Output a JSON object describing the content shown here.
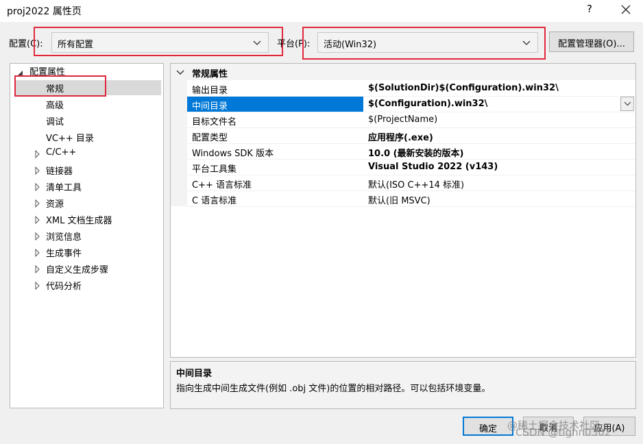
{
  "window": {
    "title": "proj2022 属性页",
    "help_label": "?"
  },
  "toolbar": {
    "config_label": "配置(C):",
    "config_value": "所有配置",
    "platform_label": "平台(P):",
    "platform_value": "活动(Win32)",
    "config_manager_label": "配置管理器(O)..."
  },
  "colors": {
    "highlight_box": "#e0283a",
    "selection": "#0078d7"
  },
  "tree": {
    "root": "配置属性",
    "items": [
      {
        "label": "常规",
        "expandable": false,
        "selected": true
      },
      {
        "label": "高级",
        "expandable": false
      },
      {
        "label": "调试",
        "expandable": false
      },
      {
        "label": "VC++ 目录",
        "expandable": false
      },
      {
        "label": "C/C++",
        "expandable": true
      },
      {
        "label": "链接器",
        "expandable": true
      },
      {
        "label": "清单工具",
        "expandable": true
      },
      {
        "label": "资源",
        "expandable": true
      },
      {
        "label": "XML 文档生成器",
        "expandable": true
      },
      {
        "label": "浏览信息",
        "expandable": true
      },
      {
        "label": "生成事件",
        "expandable": true
      },
      {
        "label": "自定义生成步骤",
        "expandable": true
      },
      {
        "label": "代码分析",
        "expandable": true
      }
    ]
  },
  "properties": {
    "group_title": "常规属性",
    "rows": [
      {
        "name": "输出目录",
        "value": "$(SolutionDir)$(Configuration).win32\\",
        "bold": true
      },
      {
        "name": "中间目录",
        "value": "$(Configuration).win32\\",
        "bold": true,
        "selected": true
      },
      {
        "name": "目标文件名",
        "value": "$(ProjectName)",
        "bold": false
      },
      {
        "name": "配置类型",
        "value": "应用程序(.exe)",
        "bold": true
      },
      {
        "name": "Windows SDK 版本",
        "value": "10.0 (最新安装的版本)",
        "bold": true
      },
      {
        "name": "平台工具集",
        "value": "Visual Studio 2022 (v143)",
        "bold": true
      },
      {
        "name": "C++ 语言标准",
        "value": "默认(ISO C++14 标准)",
        "bold": false
      },
      {
        "name": "C 语言标准",
        "value": "默认(旧 MSVC)",
        "bold": false
      }
    ]
  },
  "description": {
    "title": "中间目录",
    "text": "指向生成中间生成文件(例如 .obj 文件)的位置的相对路径。可以包括环境变量。"
  },
  "buttons": {
    "ok": "确定",
    "cancel": "取消",
    "apply": "应用(A)"
  },
  "watermark": {
    "line1": "@稀土掘金技术社区",
    "line2": "CSDN @tighn0302"
  }
}
